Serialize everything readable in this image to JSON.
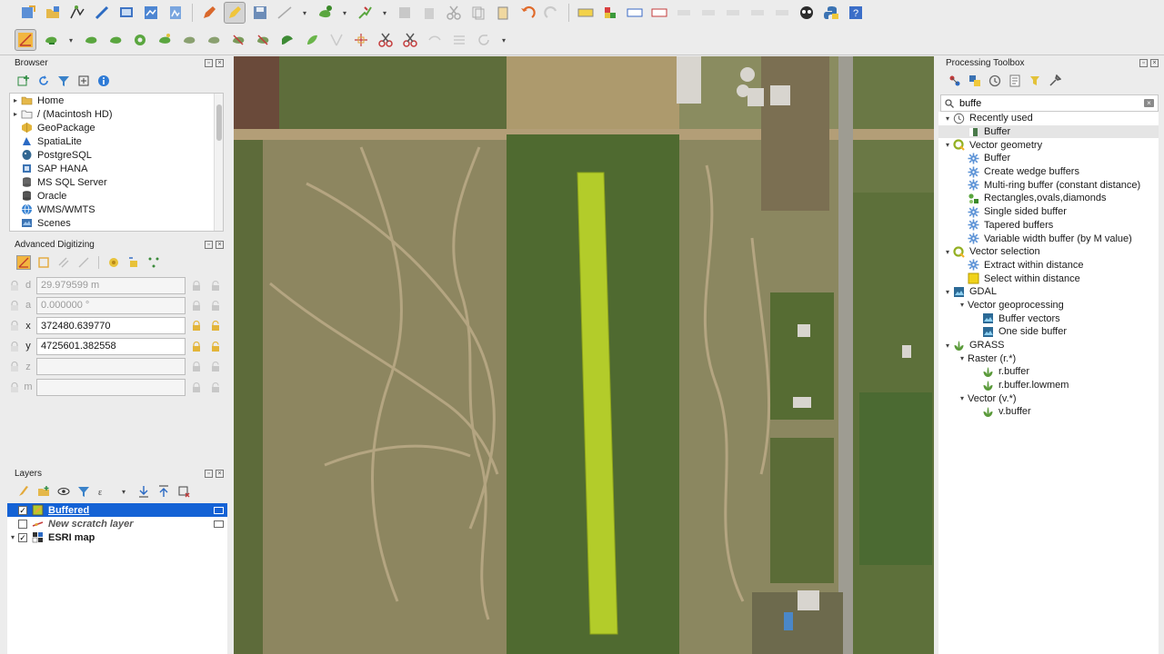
{
  "toolbar1": {
    "icons": [
      "new-project-icon",
      "open-project-icon",
      "edit-pencil-icon",
      "digitize-icon",
      "save-edits-icon",
      "add-feature-icon",
      "vertex-tool-icon",
      "delete-icon",
      "cut-icon",
      "copy-icon",
      "paste-icon",
      "undo-icon",
      "redo-icon",
      "label-icon",
      "style-icon",
      "python-icon",
      "help-icon"
    ]
  },
  "toolbar2": {
    "icons": [
      "adv-digitizing-icon",
      "add-ring-icon",
      "split-features-icon",
      "reshape-icon",
      "offset-curve-icon",
      "rotate-icon",
      "scale-icon"
    ]
  },
  "browser": {
    "title": "Browser",
    "items": [
      {
        "label": "Home",
        "icon": "folder-icon",
        "expandable": true
      },
      {
        "label": "/ (Macintosh HD)",
        "icon": "drive-icon",
        "expandable": true
      },
      {
        "label": "GeoPackage",
        "icon": "geopackage-icon",
        "expandable": false
      },
      {
        "label": "SpatiaLite",
        "icon": "spatialite-icon",
        "expandable": false
      },
      {
        "label": "PostgreSQL",
        "icon": "postgresql-icon",
        "expandable": false
      },
      {
        "label": "SAP HANA",
        "icon": "sap-hana-icon",
        "expandable": false
      },
      {
        "label": "MS SQL Server",
        "icon": "mssql-icon",
        "expandable": false
      },
      {
        "label": "Oracle",
        "icon": "oracle-icon",
        "expandable": false
      },
      {
        "label": "WMS/WMTS",
        "icon": "wms-icon",
        "expandable": false
      },
      {
        "label": "Scenes",
        "icon": "scenes-icon",
        "expandable": false
      }
    ]
  },
  "advdig": {
    "title": "Advanced Digitizing",
    "fields": [
      {
        "label": "d",
        "value": "",
        "placeholder": "29.979599 m",
        "enabled": false
      },
      {
        "label": "a",
        "value": "",
        "placeholder": "0.000000 °",
        "enabled": false
      },
      {
        "label": "x",
        "value": "372480.639770",
        "placeholder": "",
        "enabled": true
      },
      {
        "label": "y",
        "value": "4725601.382558",
        "placeholder": "",
        "enabled": true
      },
      {
        "label": "z",
        "value": "",
        "placeholder": "",
        "enabled": false
      },
      {
        "label": "m",
        "value": "",
        "placeholder": "",
        "enabled": false
      }
    ]
  },
  "layers": {
    "title": "Layers",
    "items": [
      {
        "label": "Buffered",
        "checked": true,
        "selected": true,
        "italic": false
      },
      {
        "label": "New scratch layer",
        "checked": false,
        "selected": false,
        "italic": true
      },
      {
        "label": "ESRI map",
        "checked": true,
        "selected": false,
        "italic": false
      }
    ]
  },
  "toolbox": {
    "title": "Processing Toolbox",
    "search_value": "buffe",
    "tree": [
      {
        "label": "Recently used",
        "level": 0,
        "icon": "clock-icon",
        "twist": "open",
        "highlight": false
      },
      {
        "label": "Buffer",
        "level": 1,
        "icon": "buffer-tool-icon",
        "twist": "",
        "highlight": true
      },
      {
        "label": "Vector geometry",
        "level": 0,
        "icon": "qgis-logo-icon",
        "twist": "open",
        "highlight": false
      },
      {
        "label": "Buffer",
        "level": 1,
        "icon": "gear-icon",
        "twist": "",
        "highlight": false
      },
      {
        "label": "Create wedge buffers",
        "level": 1,
        "icon": "gear-icon",
        "twist": "",
        "highlight": false
      },
      {
        "label": "Multi-ring buffer (constant distance)",
        "level": 1,
        "icon": "gear-icon",
        "twist": "",
        "highlight": false
      },
      {
        "label": "Rectangles,ovals,diamonds",
        "level": 1,
        "icon": "shapes-icon",
        "twist": "",
        "highlight": false
      },
      {
        "label": "Single sided buffer",
        "level": 1,
        "icon": "gear-icon",
        "twist": "",
        "highlight": false
      },
      {
        "label": "Tapered buffers",
        "level": 1,
        "icon": "gear-icon",
        "twist": "",
        "highlight": false
      },
      {
        "label": "Variable width buffer (by M value)",
        "level": 1,
        "icon": "gear-icon",
        "twist": "",
        "highlight": false
      },
      {
        "label": "Vector selection",
        "level": 0,
        "icon": "qgis-logo-icon",
        "twist": "open",
        "highlight": false
      },
      {
        "label": "Extract within distance",
        "level": 1,
        "icon": "gear-icon",
        "twist": "",
        "highlight": false
      },
      {
        "label": "Select within distance",
        "level": 1,
        "icon": "select-icon",
        "twist": "",
        "highlight": false
      },
      {
        "label": "GDAL",
        "level": 0,
        "icon": "gdal-icon",
        "twist": "open",
        "highlight": false
      },
      {
        "label": "Vector geoprocessing",
        "level": 1,
        "icon": "",
        "twist": "open",
        "highlight": false
      },
      {
        "label": "Buffer vectors",
        "level": 2,
        "icon": "gdal-icon",
        "twist": "",
        "highlight": false
      },
      {
        "label": "One side buffer",
        "level": 2,
        "icon": "gdal-icon",
        "twist": "",
        "highlight": false
      },
      {
        "label": "GRASS",
        "level": 0,
        "icon": "grass-icon",
        "twist": "open",
        "highlight": false
      },
      {
        "label": "Raster (r.*)",
        "level": 1,
        "icon": "",
        "twist": "open",
        "highlight": false
      },
      {
        "label": "r.buffer",
        "level": 2,
        "icon": "grass-icon",
        "twist": "",
        "highlight": false
      },
      {
        "label": "r.buffer.lowmem",
        "level": 2,
        "icon": "grass-icon",
        "twist": "",
        "highlight": false
      },
      {
        "label": "Vector (v.*)",
        "level": 1,
        "icon": "",
        "twist": "open",
        "highlight": false
      },
      {
        "label": "v.buffer",
        "level": 2,
        "icon": "grass-icon",
        "twist": "",
        "highlight": false
      }
    ]
  },
  "colors": {
    "selection": "#1462d5",
    "buffer_fill": "#b3cc2a",
    "accent": "#4b9e3a"
  }
}
